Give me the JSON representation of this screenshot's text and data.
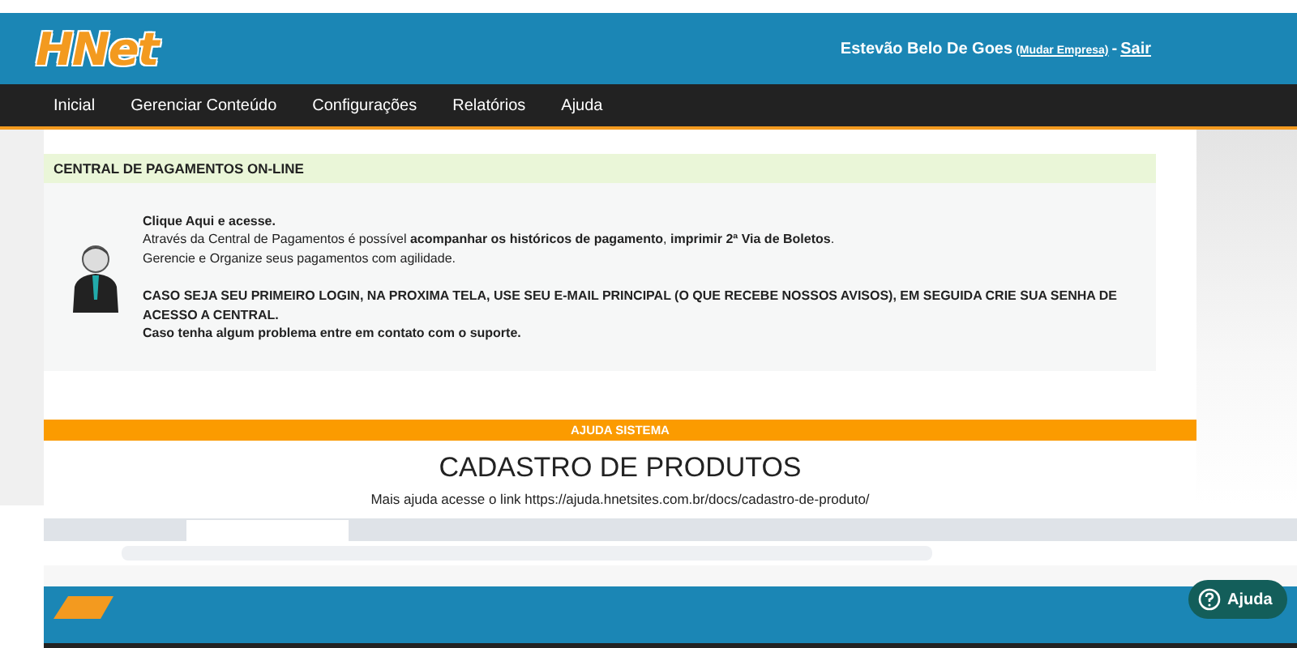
{
  "header": {
    "logo": "HNet",
    "user": "Estevão Belo De Goes",
    "switch_link": "(Mudar Empresa)",
    "separator": "-",
    "logout": "Sair"
  },
  "nav": [
    {
      "label": "Inicial"
    },
    {
      "label": "Gerenciar Conteúdo"
    },
    {
      "label": "Configurações"
    },
    {
      "label": "Relatórios"
    },
    {
      "label": "Ajuda"
    }
  ],
  "payments_panel": {
    "title": "CENTRAL DE PAGAMENTOS ON-LINE",
    "paragraphs": [
      [
        "**Clique Aqui e acesse.**",
        "Através da Central de Pagamentos é possível **acompanhar os históricos de pagamento**, **imprimir 2ª Via de Boletos**.",
        "Gerencie e Organize seus pagamentos com agilidade."
      ],
      [
        "**CASO SEJA SEU PRIMEIRO LOGIN, NA PROXIMA TELA, USE SEU E-MAIL PRINCIPAL (O QUE RECEBE NOSSOS AVISOS), EM SEGUIDA CRIE SUA SENHA DE ACESSO A CENTRAL.**",
        "**Caso tenha algum problema entre em contato com o suporte.**"
      ]
    ]
  },
  "help_section": {
    "bar": "AJUDA SISTEMA",
    "title": "CADASTRO DE PRODUTOS",
    "link_text": "Mais ajuda acesse o link https://ajuda.hnetsites.com.br/docs/cadastro-de-produto/"
  },
  "help_button": {
    "label": "Ajuda"
  }
}
